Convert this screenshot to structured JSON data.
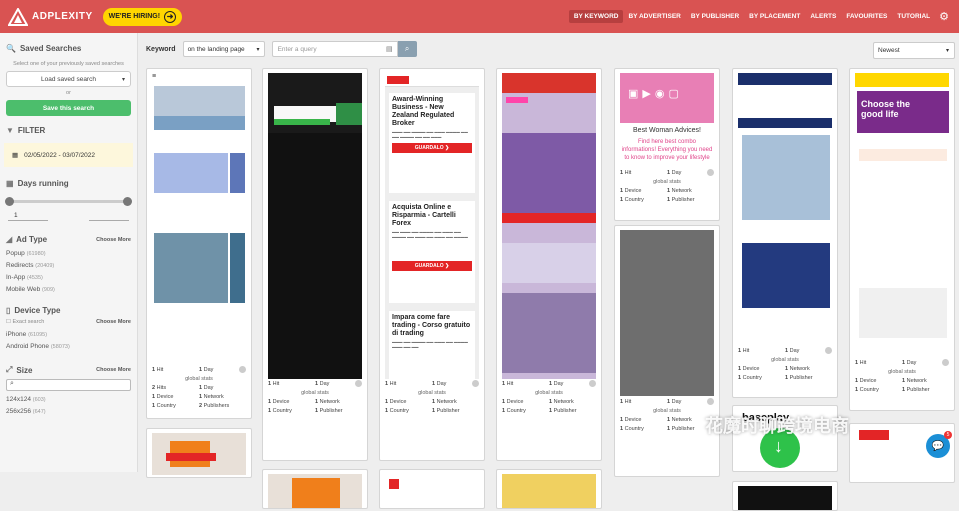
{
  "header": {
    "brand": "ADPLEXITY",
    "hiring": "WE'RE HIRING!",
    "nav": [
      "BY KEYWORD",
      "BY ADVERTISER",
      "BY PUBLISHER",
      "BY PLACEMENT",
      "ALERTS",
      "FAVOURITES",
      "TUTORIAL"
    ],
    "active_nav": "BY KEYWORD",
    "colors": {
      "bar": "#d95352",
      "accent": "#ffd500",
      "green": "#4cbe6c"
    }
  },
  "sidebar": {
    "saved_title": "Saved Searches",
    "saved_note": "Select one of your previously saved searches",
    "load_label": "Load saved search",
    "or": "or",
    "save_label": "Save this search",
    "filter_title": "FILTER",
    "date_range": "02/05/2022 - 03/07/2022",
    "days_title": "Days running",
    "days_min": "1",
    "days_max": "",
    "adtype_title": "Ad Type",
    "choose_more": "Choose More",
    "adtypes": [
      {
        "label": "Popup",
        "count": "(61980)"
      },
      {
        "label": "Redirects",
        "count": "(20409)"
      },
      {
        "label": "In-App",
        "count": "(4535)"
      },
      {
        "label": "Mobile Web",
        "count": "(909)"
      }
    ],
    "device_title": "Device Type",
    "exact_search": "Exact search",
    "devices": [
      {
        "label": "iPhone",
        "count": "(61095)"
      },
      {
        "label": "Android Phone",
        "count": "(58073)"
      }
    ],
    "size_title": "Size",
    "sizes": [
      {
        "label": "124x124",
        "count": "(603)"
      },
      {
        "label": "256x256",
        "count": "(647)"
      }
    ]
  },
  "toolbar": {
    "keyword_label": "Keyword",
    "keyword_mode": "on the landing page",
    "query_placeholder": "Enter a query",
    "sort": "Newest"
  },
  "stats_labels": {
    "hits": "Hit",
    "day": "Day",
    "global": "global stats",
    "device": "Device",
    "network": "Network",
    "country": "Country",
    "publisher": "Publisher",
    "publishers": "Publishers",
    "hits_plural": "Hits",
    "networks": "Network"
  },
  "cards": {
    "c1": {
      "hits": "1",
      "day": "1",
      "hits2": "2",
      "day2": "1",
      "dev": "1",
      "net": "1",
      "cty": "1",
      "pub": "2"
    },
    "c2": {
      "hits": "1",
      "day": "1",
      "dev": "1",
      "net": "1",
      "cty": "1",
      "pub": "1"
    },
    "c3": {
      "title1": "Award-Winning Business - New Zealand Regulated Broker",
      "btn": "GUARDALO ❯",
      "title2": "Acquista Online e Risparmia - Cartelli Forex",
      "title3": "Impara come fare trading - Corso gratuito di trading",
      "hits": "1",
      "day": "1",
      "dev": "1",
      "net": "1",
      "cty": "1",
      "pub": "1"
    },
    "c4": {
      "hits": "1",
      "day": "1",
      "dev": "1",
      "net": "1",
      "cty": "1",
      "pub": "1"
    },
    "c5": {
      "title": "Best Woman Advices!",
      "sub": "Find here best combo informations! Everything you need to know to improve your lifestyle",
      "hits": "1",
      "day": "1",
      "dev": "1",
      "net": "1",
      "cty": "1",
      "pub": "1",
      "hits_b": "1",
      "day_b": "1",
      "dev_b": "1",
      "net_b": "1",
      "cty_b": "1",
      "pub_b": "1"
    },
    "c6": {
      "hits": "1",
      "day": "1",
      "dev": "1",
      "net": "1",
      "cty": "1",
      "pub": "1",
      "brand": "baseplay"
    },
    "c7": {
      "title": "Choose the good life",
      "hits": "1",
      "day": "1",
      "dev": "1",
      "net": "1",
      "cty": "1",
      "pub": "1"
    }
  },
  "watermark": "花魔时聊跨境电商",
  "chat_badge": "5"
}
